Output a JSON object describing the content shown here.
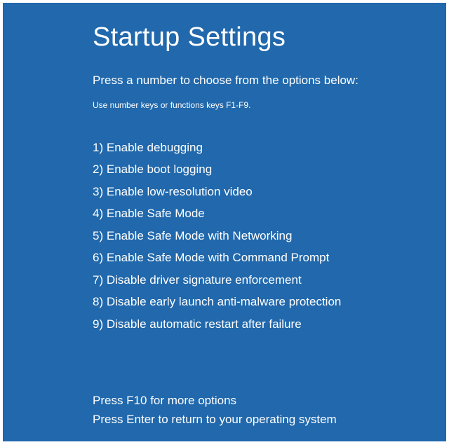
{
  "title": "Startup Settings",
  "instruction": "Press a number to choose from the options below:",
  "sub_instruction": "Use number keys or functions keys F1-F9.",
  "options": [
    {
      "num": "1",
      "label": "Enable debugging"
    },
    {
      "num": "2",
      "label": "Enable boot logging"
    },
    {
      "num": "3",
      "label": "Enable low-resolution video"
    },
    {
      "num": "4",
      "label": "Enable Safe Mode"
    },
    {
      "num": "5",
      "label": "Enable Safe Mode with Networking"
    },
    {
      "num": "6",
      "label": "Enable Safe Mode with Command Prompt"
    },
    {
      "num": "7",
      "label": "Disable driver signature enforcement"
    },
    {
      "num": "8",
      "label": "Disable early launch anti-malware protection"
    },
    {
      "num": "9",
      "label": "Disable automatic restart after failure"
    }
  ],
  "footer": {
    "line1": "Press F10 for more options",
    "line2": "Press Enter to return to your operating system"
  }
}
